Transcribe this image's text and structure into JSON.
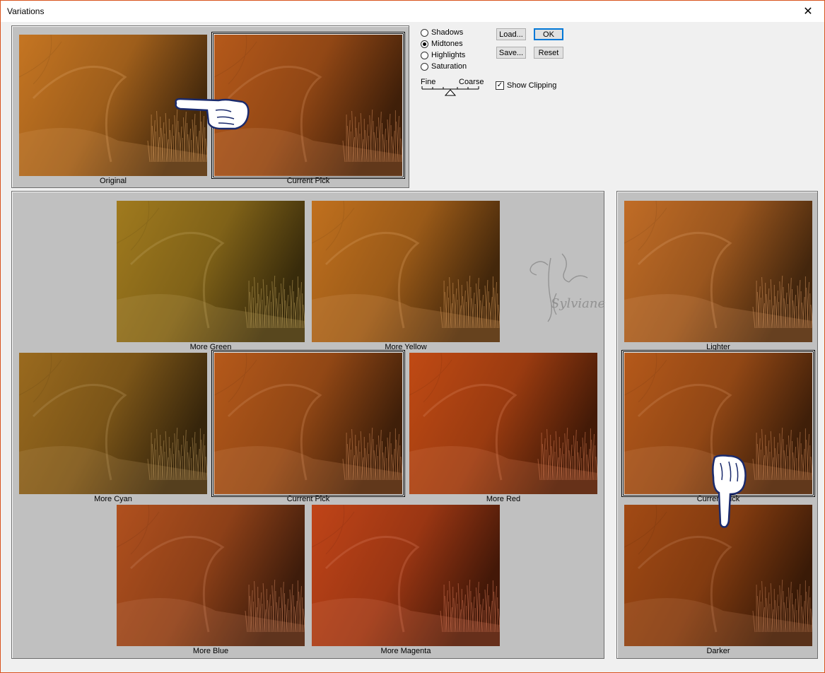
{
  "window": {
    "title": "Variations",
    "close_glyph": "✕"
  },
  "radios": [
    {
      "label": "Shadows",
      "checked": false
    },
    {
      "label": "Midtones",
      "checked": true
    },
    {
      "label": "Highlights",
      "checked": false
    },
    {
      "label": "Saturation",
      "checked": false
    }
  ],
  "buttons": {
    "load": "Load...",
    "ok": "OK",
    "save": "Save...",
    "reset": "Reset"
  },
  "slider": {
    "fine_label": "Fine",
    "coarse_label": "Coarse",
    "value_fraction": 0.5
  },
  "show_clipping": {
    "label": "Show Clipping",
    "checked": true
  },
  "top_panel": {
    "original_label": "Original",
    "current_label": "Current Pick"
  },
  "color_panel": {
    "more_green": "More Green",
    "more_yellow": "More Yellow",
    "more_cyan": "More Cyan",
    "current_pick": "Current Pick",
    "more_red": "More Red",
    "more_blue": "More Blue",
    "more_magenta": "More Magenta"
  },
  "brightness_panel": {
    "lighter": "Lighter",
    "current_pick": "Current Pick",
    "darker": "Darker"
  },
  "watermark": {
    "text": "Sylviane"
  },
  "colors": {
    "original": "#c57522",
    "current": "#b5591a",
    "more_green": "#a07a1e",
    "more_yellow": "#c0701e",
    "more_cyan": "#9a6a1e",
    "more_red": "#c04a14",
    "more_blue": "#b0501e",
    "more_magenta": "#c04418",
    "lighter": "#c06c26",
    "darker": "#a24a14"
  }
}
